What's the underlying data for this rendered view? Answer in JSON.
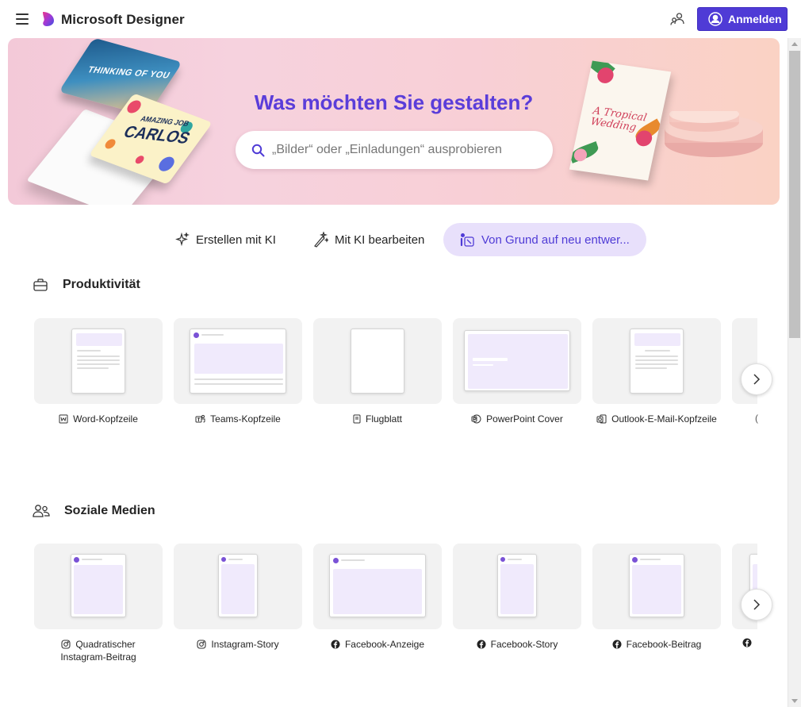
{
  "header": {
    "app_title": "Microsoft Designer",
    "signin_label": "Anmelden"
  },
  "hero": {
    "title": "Was möchten Sie gestalten?",
    "search_placeholder": "„Bilder“ oder „Einladungen“ ausprobieren",
    "card1_text": "THINKING OF YOU",
    "card2_small": "AMAZING JOB",
    "card2_big": "CARLOS",
    "card3_text": "A Tropical Wedding"
  },
  "tabs": [
    {
      "label": "Erstellen mit KI",
      "icon": "sparkle-icon"
    },
    {
      "label": "Mit KI bearbeiten",
      "icon": "magic-wand-icon"
    },
    {
      "label": "Von Grund auf neu entwer...",
      "icon": "design-icon"
    }
  ],
  "sections": {
    "productivity": {
      "title": "Produktivität",
      "icon": "briefcase-icon",
      "items": [
        {
          "label": "Word-Kopfzeile",
          "icon": "word-icon"
        },
        {
          "label": "Teams-Kopfzeile",
          "icon": "teams-icon"
        },
        {
          "label": "Flugblatt",
          "icon": "flyer-icon"
        },
        {
          "label": "PowerPoint Cover",
          "icon": "powerpoint-icon"
        },
        {
          "label": "Outlook-E-Mail-Kopfzeile",
          "icon": "outlook-icon"
        }
      ]
    },
    "social": {
      "title": "Soziale Medien",
      "icon": "people-icon",
      "items": [
        {
          "label": "Quadratischer Instagram-Beitrag",
          "icon": "instagram-icon"
        },
        {
          "label": "Instagram-Story",
          "icon": "instagram-icon"
        },
        {
          "label": "Facebook-Anzeige",
          "icon": "facebook-icon"
        },
        {
          "label": "Facebook-Story",
          "icon": "facebook-icon"
        },
        {
          "label": "Facebook-Beitrag",
          "icon": "facebook-icon"
        }
      ]
    }
  },
  "colors": {
    "brand": "#4f3bd6",
    "hero_title": "#5a3dd9",
    "active_tab_bg": "#e8e0fb"
  }
}
